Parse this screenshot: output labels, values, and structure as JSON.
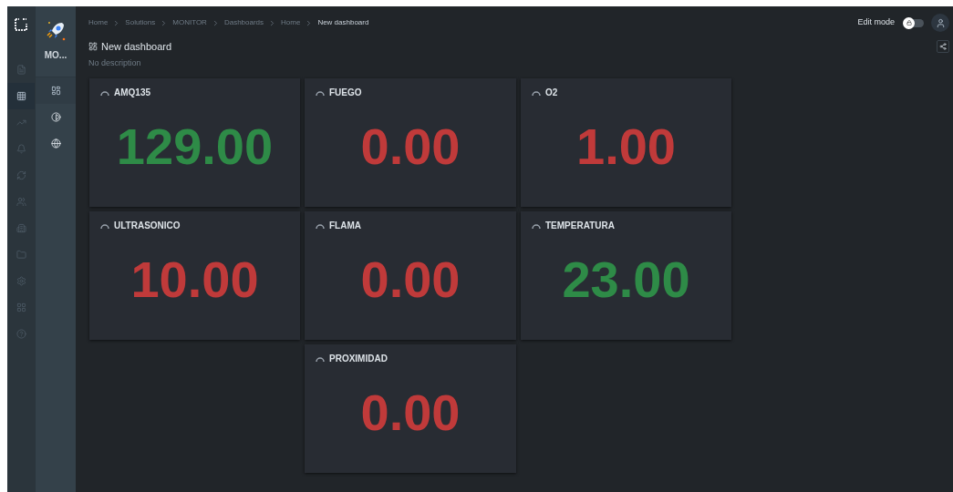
{
  "rail": [
    {
      "kind": "document",
      "selected": false
    },
    {
      "kind": "grid",
      "selected": true
    },
    {
      "kind": "chart",
      "selected": false
    },
    {
      "kind": "bell",
      "selected": false
    },
    {
      "kind": "sync",
      "selected": false
    },
    {
      "kind": "users",
      "selected": false
    },
    {
      "kind": "building",
      "selected": false
    },
    {
      "kind": "folder",
      "selected": false
    },
    {
      "kind": "settings",
      "selected": false
    },
    {
      "kind": "apps",
      "selected": false
    },
    {
      "kind": "help",
      "selected": false
    }
  ],
  "solution": {
    "name": "MO..."
  },
  "solution_menu": [
    {
      "kind": "dashboard",
      "selected": true
    },
    {
      "kind": "contrast",
      "selected": false
    },
    {
      "kind": "globe",
      "selected": false
    }
  ],
  "breadcrumbs": [
    "Home",
    "Solutions",
    "MONITOR",
    "Dashboards",
    "Home",
    "New dashboard"
  ],
  "dashboard": {
    "title": "New dashboard",
    "description": "No description"
  },
  "edit_mode": {
    "label": "Edit mode",
    "on": false
  },
  "widgets": [
    {
      "kind": "value",
      "title": "AMQ135",
      "value": "129.00",
      "alarm": false
    },
    {
      "kind": "value",
      "title": "FUEGO",
      "value": "0.00",
      "alarm": true
    },
    {
      "kind": "value",
      "title": "O2",
      "value": "1.00",
      "alarm": true
    },
    {
      "kind": "value",
      "title": "ULTRASONICO",
      "value": "10.00",
      "alarm": true
    },
    {
      "kind": "value",
      "title": "FLAMA",
      "value": "0.00",
      "alarm": true
    },
    {
      "kind": "value",
      "title": "TEMPERATURA",
      "value": "23.00",
      "alarm": false
    },
    {
      "kind": "empty"
    },
    {
      "kind": "value",
      "title": "PROXIMIDAD",
      "value": "0.00",
      "alarm": true
    }
  ]
}
